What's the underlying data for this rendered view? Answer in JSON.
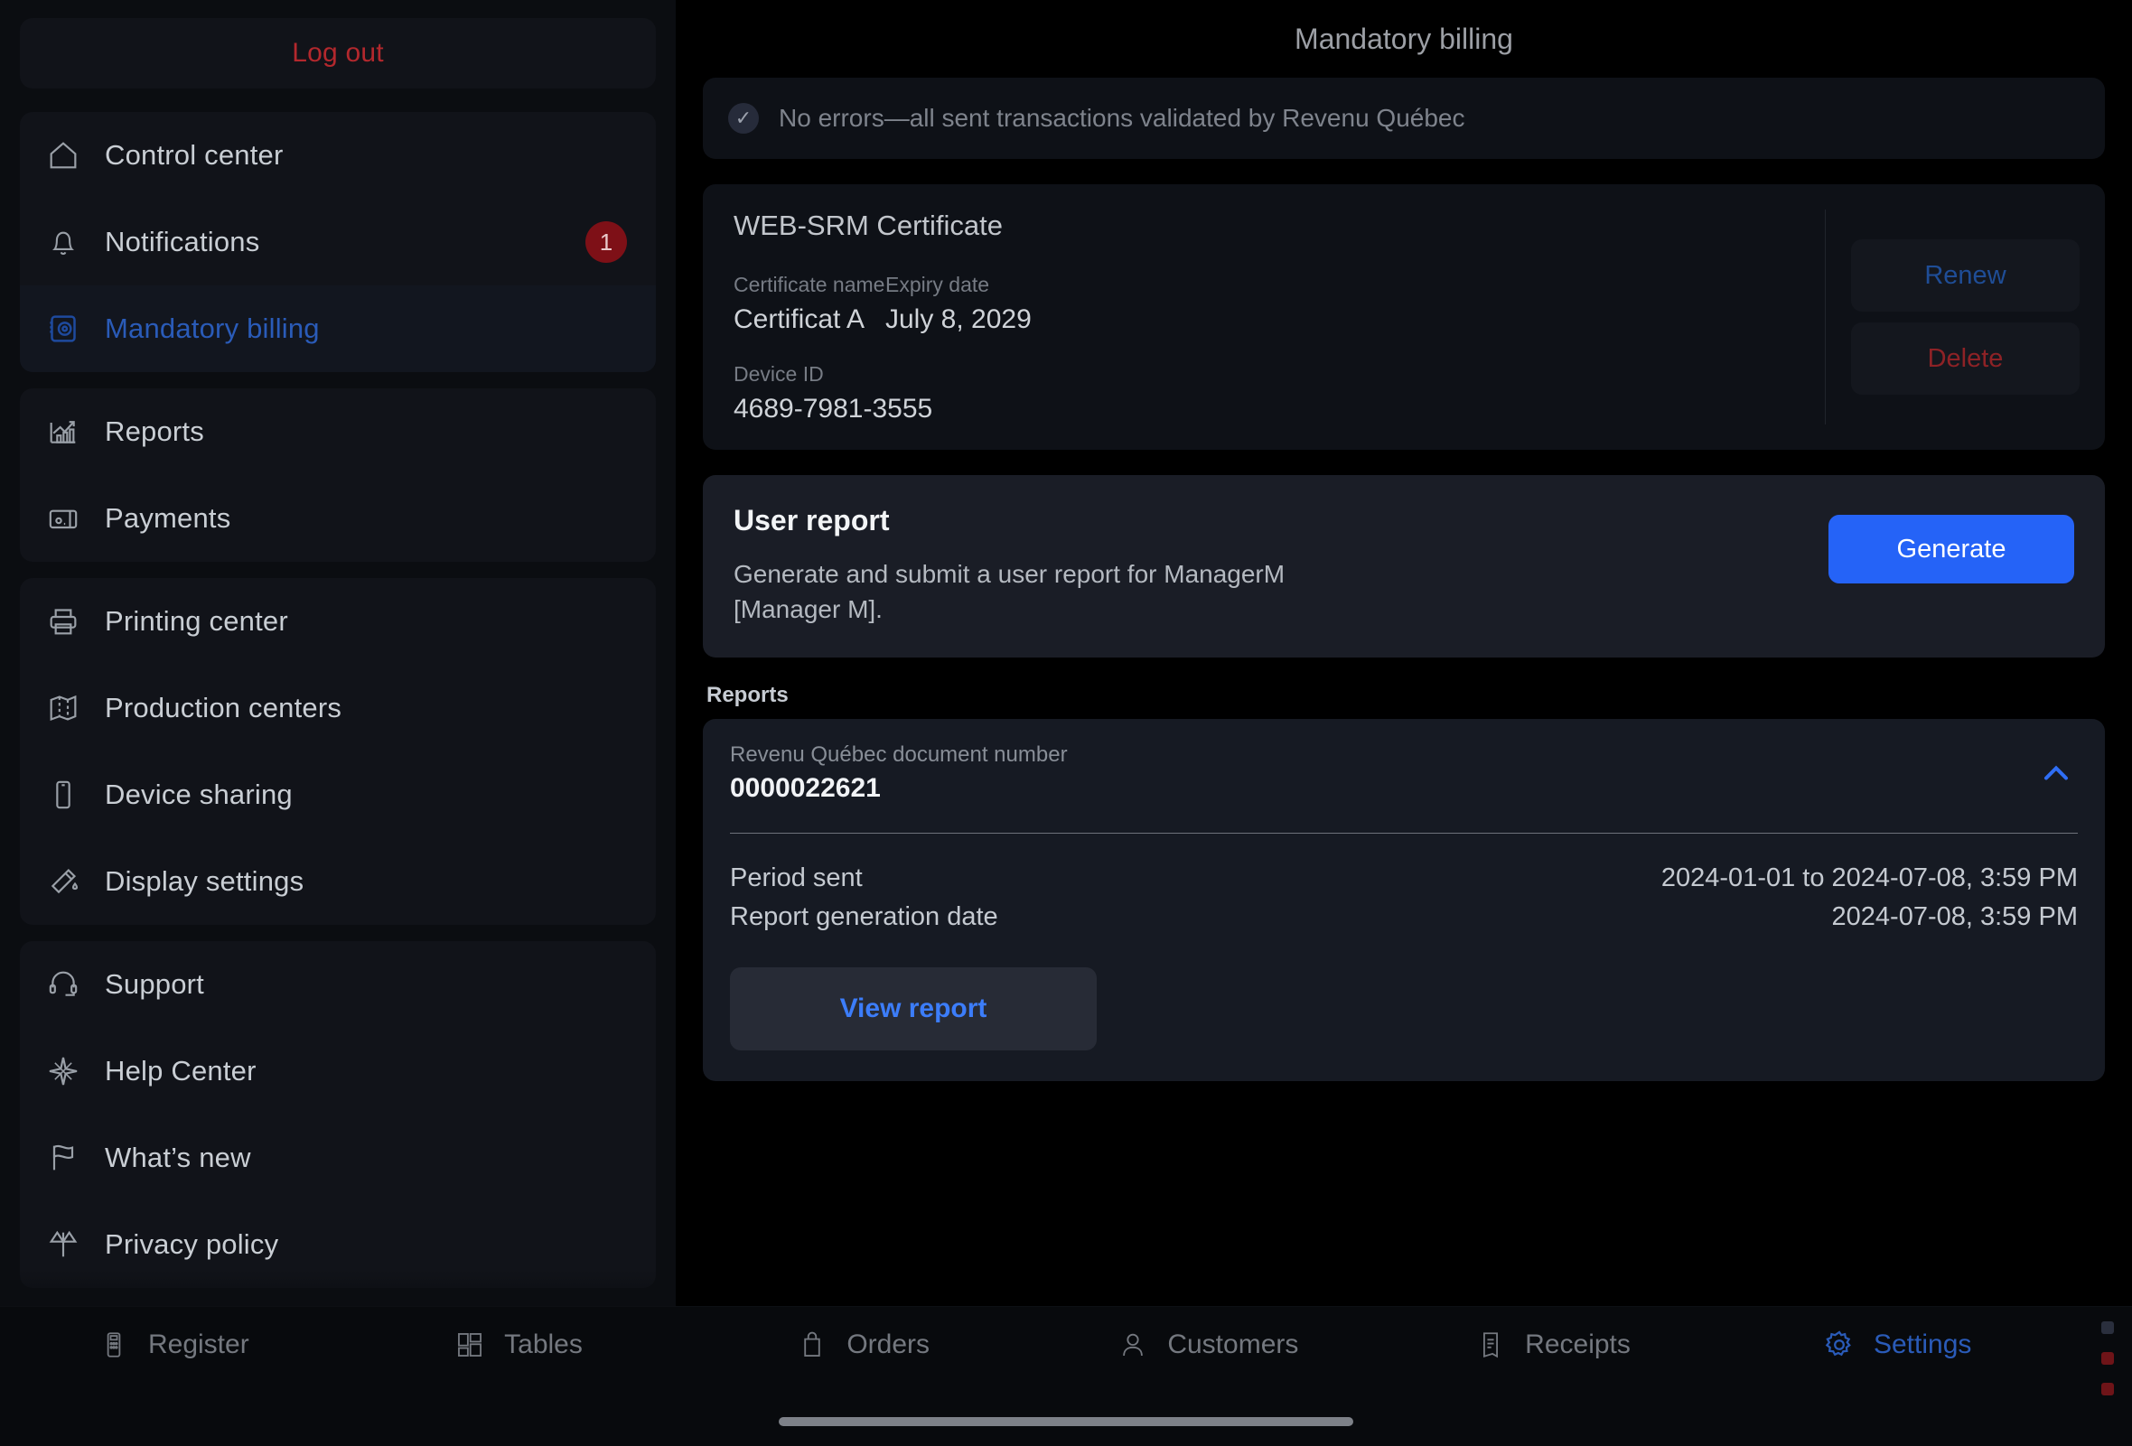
{
  "sidebar": {
    "logout_label": "Log out",
    "groups": [
      {
        "items": [
          {
            "label": "Control center",
            "icon": "home-icon",
            "active": false
          },
          {
            "label": "Notifications",
            "icon": "bell-icon",
            "active": false,
            "badge": "1"
          },
          {
            "label": "Mandatory billing",
            "icon": "safe-vault-icon",
            "active": true
          }
        ]
      },
      {
        "items": [
          {
            "label": "Reports",
            "icon": "chart-growth-icon",
            "active": false
          },
          {
            "label": "Payments",
            "icon": "wallet-icon",
            "active": false
          }
        ]
      },
      {
        "items": [
          {
            "label": "Printing center",
            "icon": "printer-icon",
            "active": false
          },
          {
            "label": "Production centers",
            "icon": "map-icon",
            "active": false
          },
          {
            "label": "Device sharing",
            "icon": "phone-icon",
            "active": false
          },
          {
            "label": "Display settings",
            "icon": "paint-roller-icon",
            "active": false
          }
        ]
      },
      {
        "items": [
          {
            "label": "Support",
            "icon": "headset-icon",
            "active": false
          },
          {
            "label": "Help Center",
            "icon": "compass-star-icon",
            "active": false
          },
          {
            "label": "What’s new",
            "icon": "flag-icon",
            "active": false
          },
          {
            "label": "Privacy policy",
            "icon": "scales-icon",
            "active": false
          }
        ]
      }
    ]
  },
  "main": {
    "title": "Mandatory billing",
    "status_banner": {
      "icon": "check-circle-icon",
      "text": "No errors—all sent transactions validated by Revenu Québec"
    },
    "certificate": {
      "title": "WEB-SRM Certificate",
      "name_label": "Certificate name",
      "name_value": "Certificat A",
      "expiry_label": "Expiry date",
      "expiry_value": "July 8, 2029",
      "device_label": "Device ID",
      "device_value": "4689-7981-3555",
      "renew_label": "Renew",
      "delete_label": "Delete"
    },
    "user_report": {
      "title": "User report",
      "description": "Generate and submit a user report for ManagerM [Manager M].",
      "generate_label": "Generate"
    },
    "reports_section": {
      "section_label": "Reports",
      "doc_number_label": "Revenu Québec document number",
      "doc_number_value": "0000022621",
      "collapse_icon": "chevron-up-icon",
      "rows": [
        {
          "key": "Period sent",
          "value": "2024-01-01 to 2024-07-08, 3:59 PM"
        },
        {
          "key": "Report generation date",
          "value": "2024-07-08, 3:59 PM"
        }
      ],
      "view_report_label": "View report"
    }
  },
  "bottom_nav": {
    "items": [
      {
        "label": "Register",
        "icon": "register-icon",
        "active": false
      },
      {
        "label": "Tables",
        "icon": "tables-grid-icon",
        "active": false
      },
      {
        "label": "Orders",
        "icon": "bag-icon",
        "active": false
      },
      {
        "label": "Customers",
        "icon": "person-icon",
        "active": false
      },
      {
        "label": "Receipts",
        "icon": "receipt-icon",
        "active": false
      },
      {
        "label": "Settings",
        "icon": "gear-icon",
        "active": true
      }
    ]
  },
  "colors": {
    "accent_blue": "#2563f7",
    "link_blue": "#3c7dfa",
    "active_blue": "#2a5bb8",
    "danger_red": "#b3282d",
    "badge_red": "#7e1017",
    "background": "#000000",
    "card": "#0e1117",
    "card_raised": "#1a1d26"
  }
}
